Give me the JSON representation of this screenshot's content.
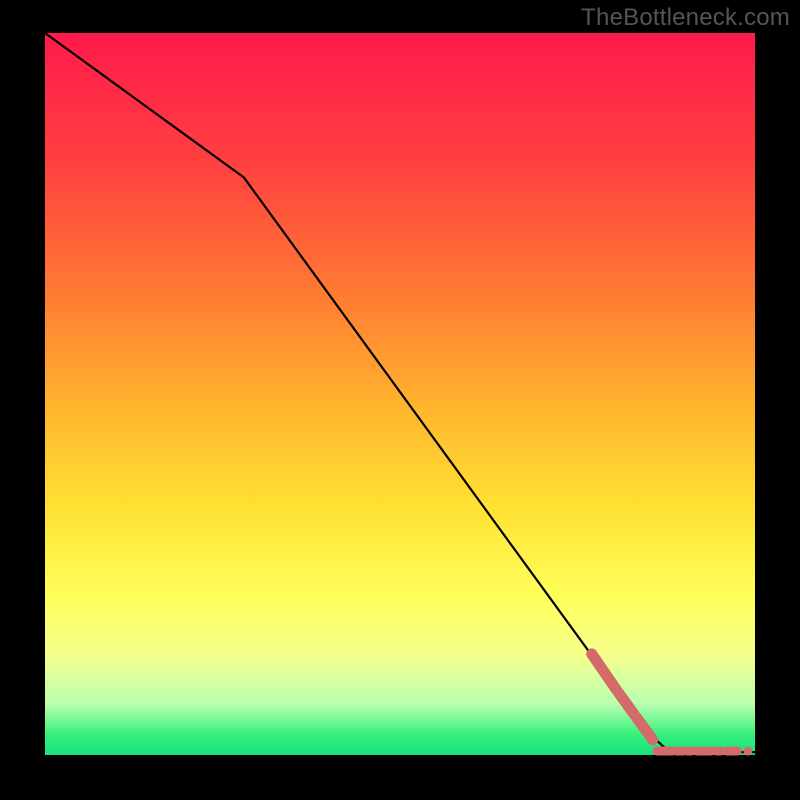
{
  "watermark": "TheBottleneck.com",
  "chart_data": {
    "type": "line",
    "title": "",
    "xlabel": "",
    "ylabel": "",
    "xlim": [
      0,
      100
    ],
    "ylim": [
      0,
      100
    ],
    "grid": false,
    "series": [
      {
        "name": "curve",
        "x": [
          0,
          28,
          85,
          88,
          100
        ],
        "y": [
          100,
          80,
          3,
          0.4,
          0.4
        ]
      }
    ],
    "markers": {
      "diagonal_segments": [
        {
          "x": [
            77.0,
            80.5
          ],
          "y": [
            14.0,
            9.0
          ]
        },
        {
          "x": [
            80.8,
            83.0
          ],
          "y": [
            8.6,
            5.6
          ]
        },
        {
          "x": [
            83.3,
            84.2
          ],
          "y": [
            5.2,
            4.0
          ]
        },
        {
          "x": [
            84.5,
            85.6
          ],
          "y": [
            3.6,
            2.1
          ]
        }
      ],
      "horizontal_segments": [
        {
          "x": [
            86.2,
            88.3
          ],
          "y": 0.55
        },
        {
          "x": [
            89.0,
            89.8
          ],
          "y": 0.55
        },
        {
          "x": [
            90.5,
            91.0
          ],
          "y": 0.55
        },
        {
          "x": [
            91.8,
            93.8
          ],
          "y": 0.55
        },
        {
          "x": [
            94.6,
            95.1
          ],
          "y": 0.55
        },
        {
          "x": [
            96.0,
            97.5
          ],
          "y": 0.55
        }
      ],
      "dots": [
        {
          "x": 99.0,
          "y": 0.55
        }
      ]
    },
    "colors": {
      "curve": "#000000",
      "markers": "#d46a6a",
      "gradient_top": "#ff1a4b",
      "gradient_bottom": "#15e27a"
    }
  }
}
